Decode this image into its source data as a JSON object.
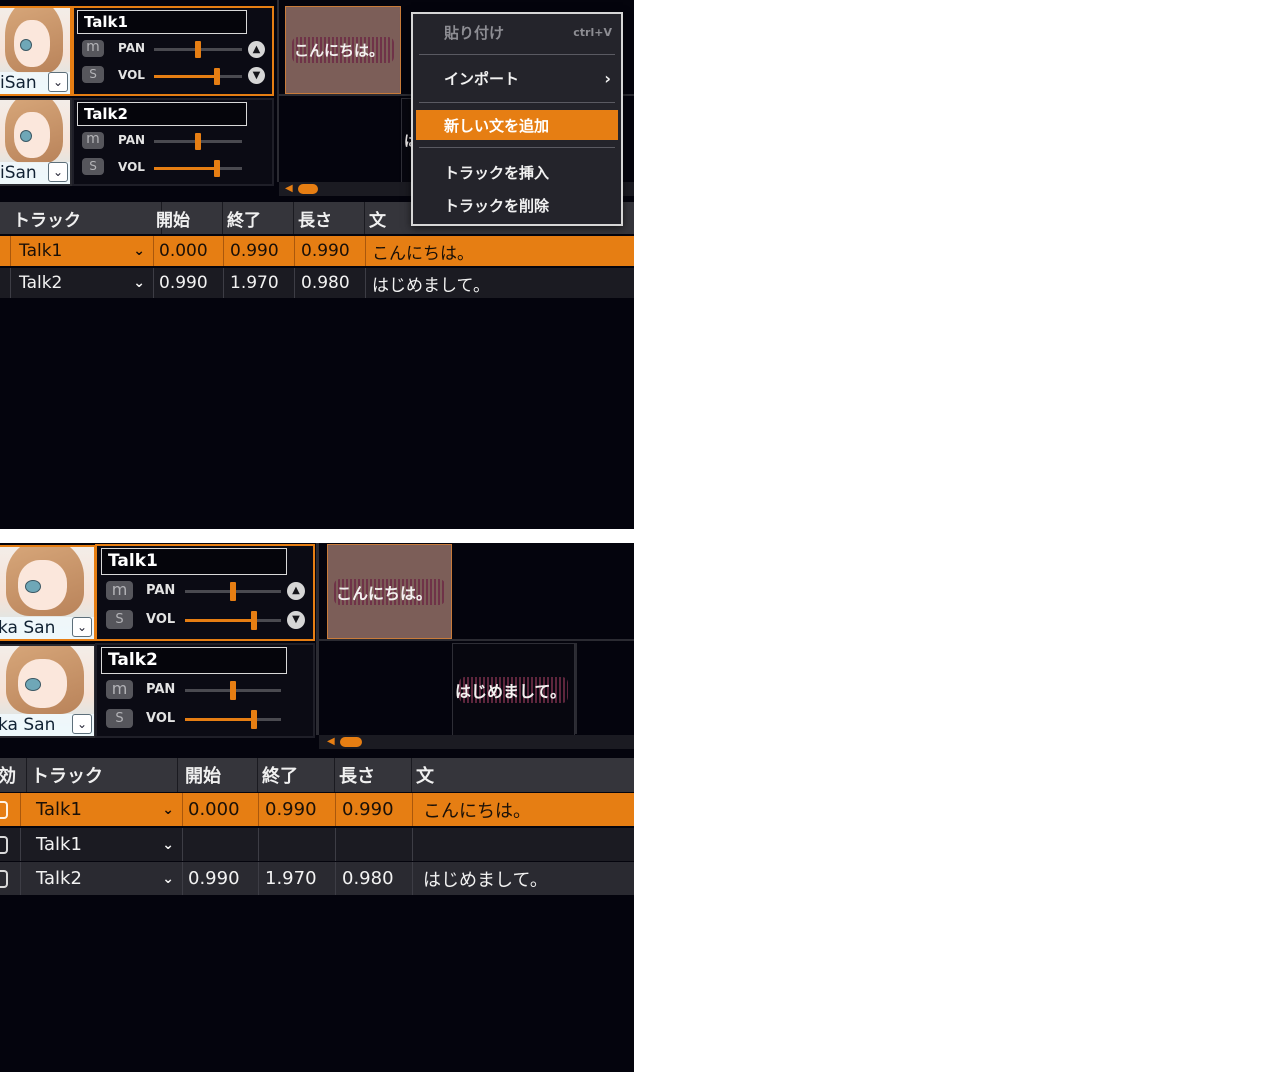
{
  "top": {
    "tracks": [
      {
        "name": "Talk1",
        "character": "iSan",
        "pan_label": "PAN",
        "vol_label": "VOL",
        "m_label": "m",
        "s_label": "S",
        "pan_level": 0.5,
        "vol_level": 0.72
      },
      {
        "name": "Talk2",
        "character": "iSan",
        "pan_label": "PAN",
        "vol_label": "VOL",
        "m_label": "m",
        "s_label": "S",
        "pan_level": 0.5,
        "vol_level": 0.72
      }
    ],
    "clips": [
      {
        "text": "こんにちは。"
      },
      {
        "text": "は"
      }
    ],
    "columns": [
      "トラック",
      "開始",
      "終了",
      "長さ",
      "文"
    ],
    "rows": [
      {
        "track": "Talk1",
        "start": "0.000",
        "end": "0.990",
        "length": "0.990",
        "text": "こんにちは。"
      },
      {
        "track": "Talk2",
        "start": "0.990",
        "end": "1.970",
        "length": "0.980",
        "text": "はじめまして。"
      }
    ],
    "context_menu": {
      "paste": "貼り付け",
      "paste_shortcut": "ctrl+V",
      "import": "インポート",
      "add_sentence": "新しい文を追加",
      "insert_track": "トラックを挿入",
      "delete_track": "トラックを削除"
    }
  },
  "bottom": {
    "tracks": [
      {
        "name": "Talk1",
        "character": "ka San",
        "pan_label": "PAN",
        "vol_label": "VOL",
        "m_label": "m",
        "s_label": "S",
        "pan_level": 0.5,
        "vol_level": 0.72
      },
      {
        "name": "Talk2",
        "character": "ka San",
        "pan_label": "PAN",
        "vol_label": "VOL",
        "m_label": "m",
        "s_label": "S",
        "pan_level": 0.5,
        "vol_level": 0.72
      }
    ],
    "clips": [
      {
        "text": "こんにちは。"
      },
      {
        "text": "はじめまして。"
      }
    ],
    "columns": [
      "効",
      "トラック",
      "開始",
      "終了",
      "長さ",
      "文"
    ],
    "rows": [
      {
        "track": "Talk1",
        "start": "0.000",
        "end": "0.990",
        "length": "0.990",
        "text": "こんにちは。"
      },
      {
        "track": "Talk1",
        "start": "",
        "end": "",
        "length": "",
        "text": ""
      },
      {
        "track": "Talk2",
        "start": "0.990",
        "end": "1.970",
        "length": "0.980",
        "text": "はじめまして。"
      }
    ]
  },
  "colors": {
    "accent": "#e67e13",
    "background": "#04040d",
    "header": "#35353b"
  },
  "icons": [
    "chevron-down-icon",
    "chevron-right-icon",
    "arrow-up-icon",
    "arrow-down-icon",
    "scroll-left-icon"
  ]
}
